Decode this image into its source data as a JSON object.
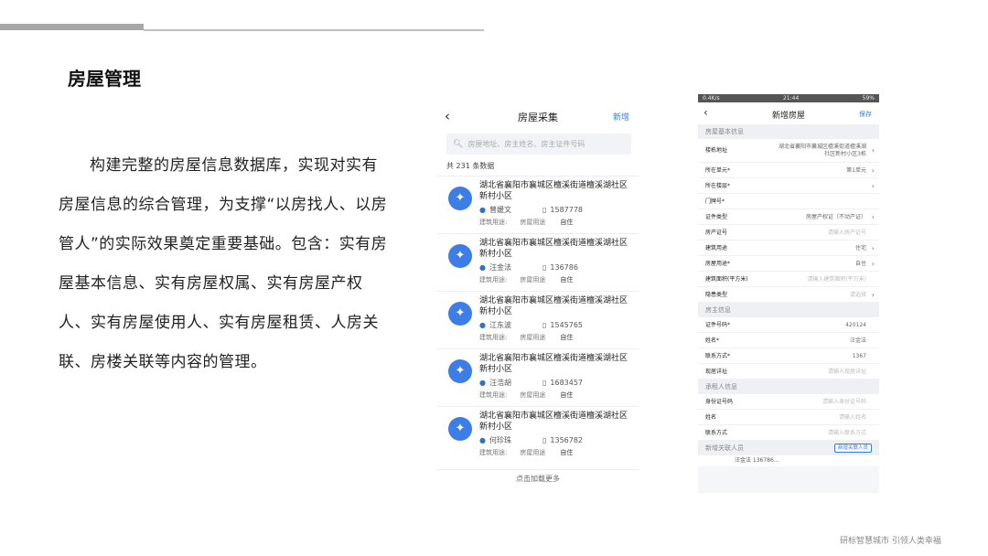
{
  "slide": {
    "title": "房屋管理",
    "body": "构建完整的房屋信息数据库，实现对实有房屋信息的综合管理，为支撑“以房找人、以房管人”的实际效果奠定重要基础。包含：实有房屋基本信息、实有房屋权属、实有房屋产权人、实有房屋使用人、实有房屋租赁、人房关联、房楼关联等内容的管理。",
    "footer": "研标智慧城市 引领人类幸福"
  },
  "phone1": {
    "back_icon": "‹",
    "title": "房屋采集",
    "action": "新增",
    "search_icon": "search-icon",
    "search_placeholder": "房屋地址、房主姓名、房主证件号码",
    "count": "共 231 条数据",
    "items": [
      {
        "address": "湖北省襄阳市襄城区檀溪街道檀溪湖社区新村小区",
        "name": "曾媛文",
        "phone": "1587778",
        "label_use": "建筑用途:",
        "label_house": "房屋用途",
        "house_use": "自住"
      },
      {
        "address": "湖北省襄阳市襄城区檀溪街道檀溪湖社区新村小区",
        "name": "汪金法",
        "phone": "136786",
        "label_use": "建筑用途:",
        "label_house": "房屋用途",
        "house_use": "自住"
      },
      {
        "address": "湖北省襄阳市襄城区檀溪街道檀溪湖社区新村小区",
        "name": "江东波",
        "phone": "1545765",
        "label_use": "建筑用途:",
        "label_house": "房屋用途",
        "house_use": "自住"
      },
      {
        "address": "湖北省襄阳市襄城区檀溪街道檀溪湖社区新村小区",
        "name": "汪浩胡",
        "phone": "1683457",
        "label_use": "建筑用途:",
        "label_house": "房屋用途",
        "house_use": "自住"
      },
      {
        "address": "湖北省襄阳市襄城区檀溪街道檀溪湖社区新村小区",
        "name": "何珍珠",
        "phone": "1356782",
        "label_use": "建筑用途:",
        "label_house": "房屋用途",
        "house_use": "自住"
      }
    ],
    "load_more": "点击加载更多"
  },
  "phone2": {
    "status_left": "0.4K/s",
    "status_time": "21:44",
    "status_right": "59%",
    "back_icon": "‹",
    "title": "新增房屋",
    "save": "保存",
    "section_basic": "房屋基本信息",
    "rows_basic": [
      {
        "label": "楼栋地址",
        "value": "湖北省襄阳市襄城区檀溪街道檀溪湖社区新村小区3栋",
        "chev": "›"
      },
      {
        "label": "所在单元*",
        "value": "第1单元",
        "chev": "›"
      },
      {
        "label": "所在楼层*",
        "value": "",
        "chev": "›"
      },
      {
        "label": "门牌号*",
        "value": "",
        "chev": ""
      },
      {
        "label": "证件类型",
        "value": "房屋产权证（不动产证）",
        "chev": "›"
      },
      {
        "label": "房产证号",
        "value": "请输入房产证号",
        "chev": ""
      },
      {
        "label": "建筑用途",
        "value": "住宅",
        "chev": "›"
      },
      {
        "label": "房屋用途*",
        "value": "自住",
        "chev": "›"
      },
      {
        "label": "建筑面积(平方米)",
        "value": "请输入建筑面积(平方米)",
        "chev": ""
      },
      {
        "label": "隐患类型",
        "value": "请选择",
        "chev": "›"
      }
    ],
    "section_owner": "房主信息",
    "rows_owner": [
      {
        "label": "证件号码*",
        "value": "420124"
      },
      {
        "label": "姓名*",
        "value": "汪金法"
      },
      {
        "label": "联系方式*",
        "value": "1367"
      },
      {
        "label": "现居详址",
        "value": "请输入现居详址"
      }
    ],
    "section_tenant": "承租人信息",
    "rows_tenant": [
      {
        "label": "身份证号码",
        "value": "请输入身份证号码"
      },
      {
        "label": "姓名",
        "value": "请输入姓名"
      },
      {
        "label": "联系方式",
        "value": "请输入联系方式"
      }
    ],
    "section_related": "新增关联人员",
    "add_related_button": "新增关联人员",
    "cut_line": "汪金法 136786..."
  }
}
